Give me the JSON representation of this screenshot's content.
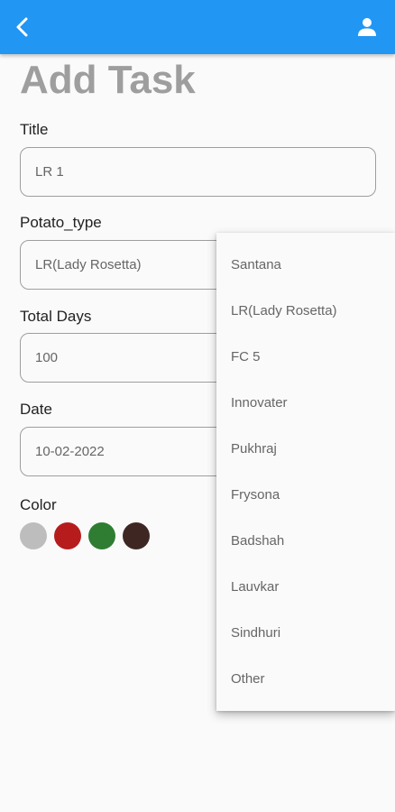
{
  "appbar": {
    "color": "#2196f3",
    "back_icon": "back-arrow-icon",
    "user_icon": "person-icon"
  },
  "page_title": "Add Task",
  "form": {
    "title_label": "Title",
    "title_value": "LR 1",
    "potato_type_label": "Potato_type",
    "potato_type_value": "LR(Lady Rosetta)",
    "total_days_label": "Total Days",
    "total_days_value": "100",
    "date_label": "Date",
    "date_value": "10-02-2022",
    "color_label": "Color",
    "colors": [
      "#bdbdbd",
      "#b71c1c",
      "#2e7d32",
      "#3e2723"
    ]
  },
  "dropdown": {
    "options": [
      "Santana",
      "LR(Lady Rosetta)",
      "FC 5",
      "Innovater",
      "Pukhraj",
      "Frysona",
      "Badshah",
      "Lauvkar",
      "Sindhuri",
      "Other"
    ]
  }
}
